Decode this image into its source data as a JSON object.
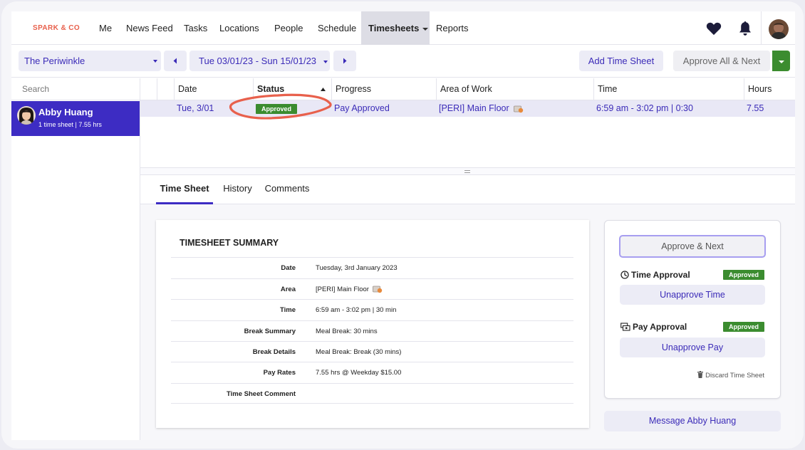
{
  "nav": {
    "brand": "SPARK & CO",
    "items": [
      "Me",
      "News Feed",
      "Tasks",
      "Locations",
      "People",
      "Schedule",
      "Timesheets",
      "Reports"
    ],
    "active": "Timesheets"
  },
  "toolbar": {
    "location": "The Periwinkle",
    "date_range": "Tue 03/01/23 - Sun 15/01/23",
    "add_label": "Add Time Sheet",
    "approve_all_label": "Approve All & Next"
  },
  "sidebar": {
    "search_placeholder": "Search",
    "person_name": "Abby Huang",
    "person_sub": "1 time sheet | 7.55 hrs"
  },
  "grid": {
    "headers": [
      "Date",
      "Status",
      "Progress",
      "Area of Work",
      "Time",
      "Hours"
    ],
    "row": {
      "date": "Tue, 3/01",
      "status": "Approved",
      "progress": "Pay Approved",
      "area": "[PERI] Main Floor",
      "time": "6:59 am - 3:02 pm | 0:30",
      "hours": "7.55"
    }
  },
  "tabs": [
    "Time Sheet",
    "History",
    "Comments"
  ],
  "summary": {
    "title": "TIMESHEET SUMMARY",
    "rows": [
      {
        "label": "Date",
        "value": "Tuesday, 3rd January 2023"
      },
      {
        "label": "Area",
        "value": "[PERI] Main Floor"
      },
      {
        "label": "Time",
        "value": "6:59 am - 3:02 pm | 30 min"
      },
      {
        "label": "Break Summary",
        "value": "Meal Break: 30 mins"
      },
      {
        "label": "Break Details",
        "value": "Meal Break: Break (30 mins)"
      },
      {
        "label": "Pay Rates",
        "value": "7.55 hrs @ Weekday $15.00"
      },
      {
        "label": "Time Sheet Comment",
        "value": ""
      }
    ]
  },
  "approval": {
    "approve_next": "Approve & Next",
    "time_label": "Time Approval",
    "time_badge": "Approved",
    "unapprove_time": "Unapprove Time",
    "pay_label": "Pay Approval",
    "pay_badge": "Approved",
    "unapprove_pay": "Unapprove Pay",
    "discard": "Discard Time Sheet",
    "message": "Message Abby Huang"
  },
  "colors": {
    "accent": "#3d2cc3",
    "link": "#3b2bb8",
    "approved": "#3b8c2f",
    "brand": "#e8604c",
    "annotation": "#e8604c"
  }
}
